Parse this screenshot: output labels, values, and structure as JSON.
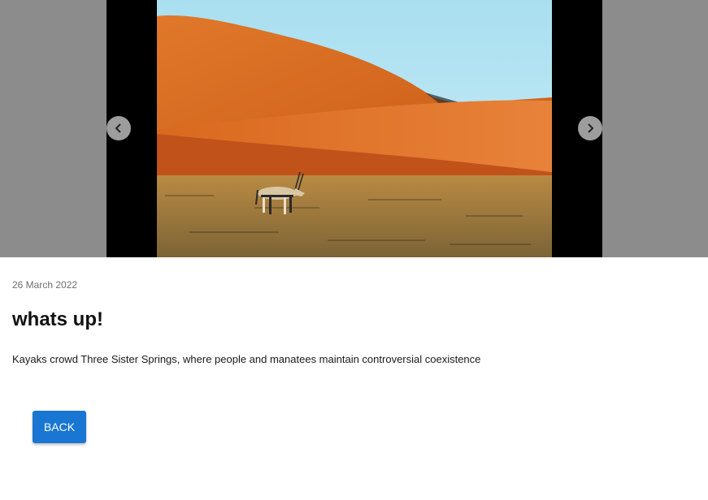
{
  "post": {
    "date": "26 March 2022",
    "title": "whats up!",
    "description": "Kayaks crowd Three Sister Springs, where people and manatees maintain controversial coexistence"
  },
  "carousel": {
    "prev_icon": "chevron-left-icon",
    "next_icon": "chevron-right-icon",
    "image_subject": "desert-dunes-oryx"
  },
  "actions": {
    "back_label": "BACK"
  },
  "colors": {
    "accent": "#1976d2",
    "carousel_bg": "#8c8c8c"
  }
}
